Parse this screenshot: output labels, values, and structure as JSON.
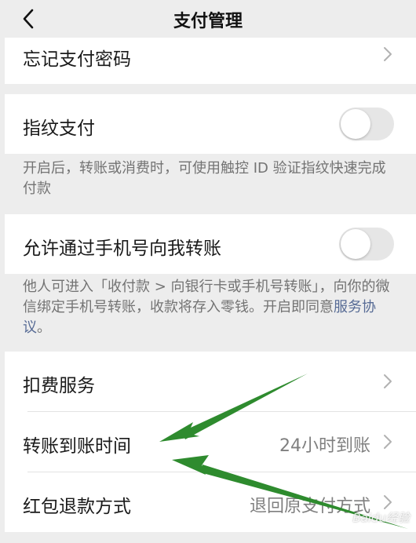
{
  "nav": {
    "title": "支付管理",
    "back_icon": "chevron-left-icon"
  },
  "rows": {
    "forgot_password": {
      "label": "忘记支付密码"
    },
    "fingerprint": {
      "label": "指纹支付",
      "enabled": false
    },
    "fingerprint_desc": "开启后，转账或消费时，可使用触控 ID 验证指纹快速完成付款",
    "phone_transfer": {
      "label": "允许通过手机号向我转账",
      "enabled": false
    },
    "phone_transfer_desc": "他人可进入「收付款 > 向银行卡或手机号转账」，向你的微信绑定手机号转账，收款将存入零钱。开启即同意",
    "phone_transfer_link": "服务协议",
    "phone_transfer_end": "。",
    "deduction": {
      "label": "扣费服务"
    },
    "arrival_time": {
      "label": "转账到账时间",
      "value": "24小时到账"
    },
    "refund": {
      "label": "红包退款方式",
      "value": "退回原支付方式"
    }
  },
  "colors": {
    "background": "#ededed",
    "cell": "#ffffff",
    "link": "#576b95",
    "annotation_arrow": "#2e8b2e"
  },
  "watermark": "Baidu经验"
}
